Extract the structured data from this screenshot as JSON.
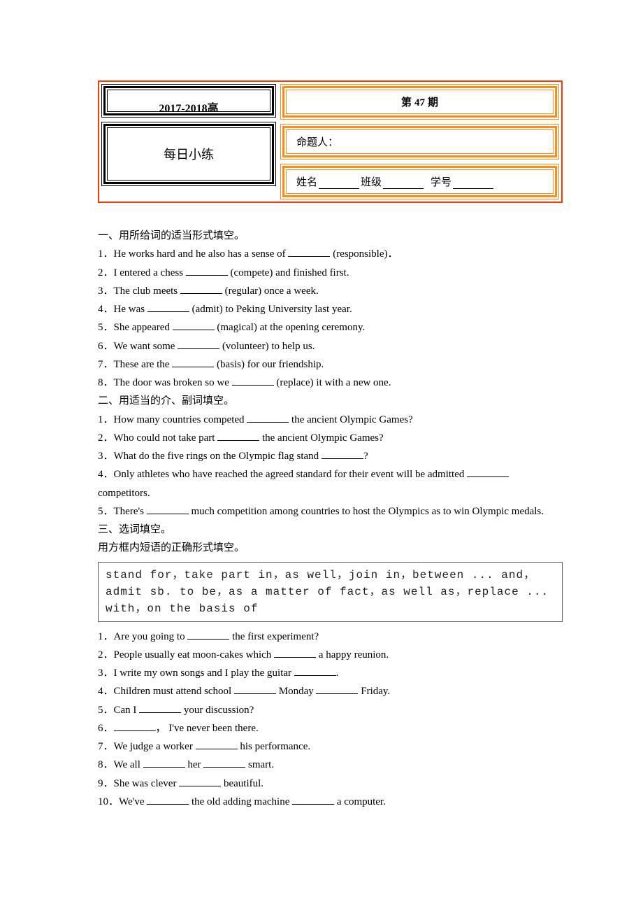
{
  "header": {
    "top_left": "2017-2018高",
    "bottom_left": "每日小练",
    "issue_prefix": "第",
    "issue_num": "47",
    "issue_suffix": "期",
    "author_label": "命题人：",
    "name_label": "姓名",
    "class_label": "班级",
    "sid_label": "学号"
  },
  "s1": {
    "title": "一、用所给词的适当形式填空。",
    "q": [
      {
        "pre": "1．He works hard and he also has a sense of ",
        "hint": " (responsible)．"
      },
      {
        "pre": "2．I entered a chess ",
        "hint": " (compete) and finished first."
      },
      {
        "pre": "3．The club meets ",
        "hint": " (regular) once a week."
      },
      {
        "pre": "4．He was ",
        "hint": " (admit) to Peking University last year."
      },
      {
        "pre": "5．She appeared ",
        "hint": " (magical) at the opening ceremony."
      },
      {
        "pre": "6．We want some ",
        "hint": " (volunteer) to help us."
      },
      {
        "pre": "7．These are the ",
        "hint": " (basis) for our friendship."
      },
      {
        "pre": "8．The door was broken so we ",
        "hint": " (replace) it with a new one."
      }
    ]
  },
  "s2": {
    "title": "二、用适当的介、副词填空。",
    "q": [
      {
        "pre": "1．How many countries competed ",
        "post": " the ancient Olympic Games?"
      },
      {
        "pre": "2．Who could not take part ",
        "post": " the ancient Olympic Games?"
      },
      {
        "pre": "3．What do the five rings on the Olympic flag stand ",
        "post": "?"
      },
      {
        "pre": "4．Only athletes who have reached the agreed standard for their event will be admitted ",
        "post": " competitors."
      },
      {
        "pre": "5．There's ",
        "post": " much competition among countries to host the Olympics as to win Olympic medals."
      }
    ]
  },
  "s3": {
    "title": "三、选词填空。",
    "sub": "用方框内短语的正确形式填空。",
    "box": "stand for，take part in，as well，join in，between ... and，admit sb. to be，as a matter of fact，as well as，replace ... with，on the basis of",
    "q": [
      {
        "pre": "1．Are you going to ",
        "post": " the first experiment?"
      },
      {
        "pre": "2．People usually eat moon-cakes which ",
        "post": " a happy reunion."
      },
      {
        "pre": "3．I write my own songs and I play the guitar ",
        "post": "."
      },
      {
        "pre": "4．Children must attend school ",
        "post": " Monday ",
        "post2": " Friday."
      },
      {
        "pre": "5．Can I ",
        "post": " your discussion?"
      },
      {
        "pre": "6．",
        "post": "， I've never been there."
      },
      {
        "pre": "7．We judge a worker ",
        "post": " his performance."
      },
      {
        "pre": "8．We all ",
        "post": " her ",
        "post2": " smart."
      },
      {
        "pre": "9．She was clever ",
        "post": " beautiful."
      },
      {
        "pre": "10．We've ",
        "post": " the old adding machine ",
        "post2": " a computer."
      }
    ]
  }
}
